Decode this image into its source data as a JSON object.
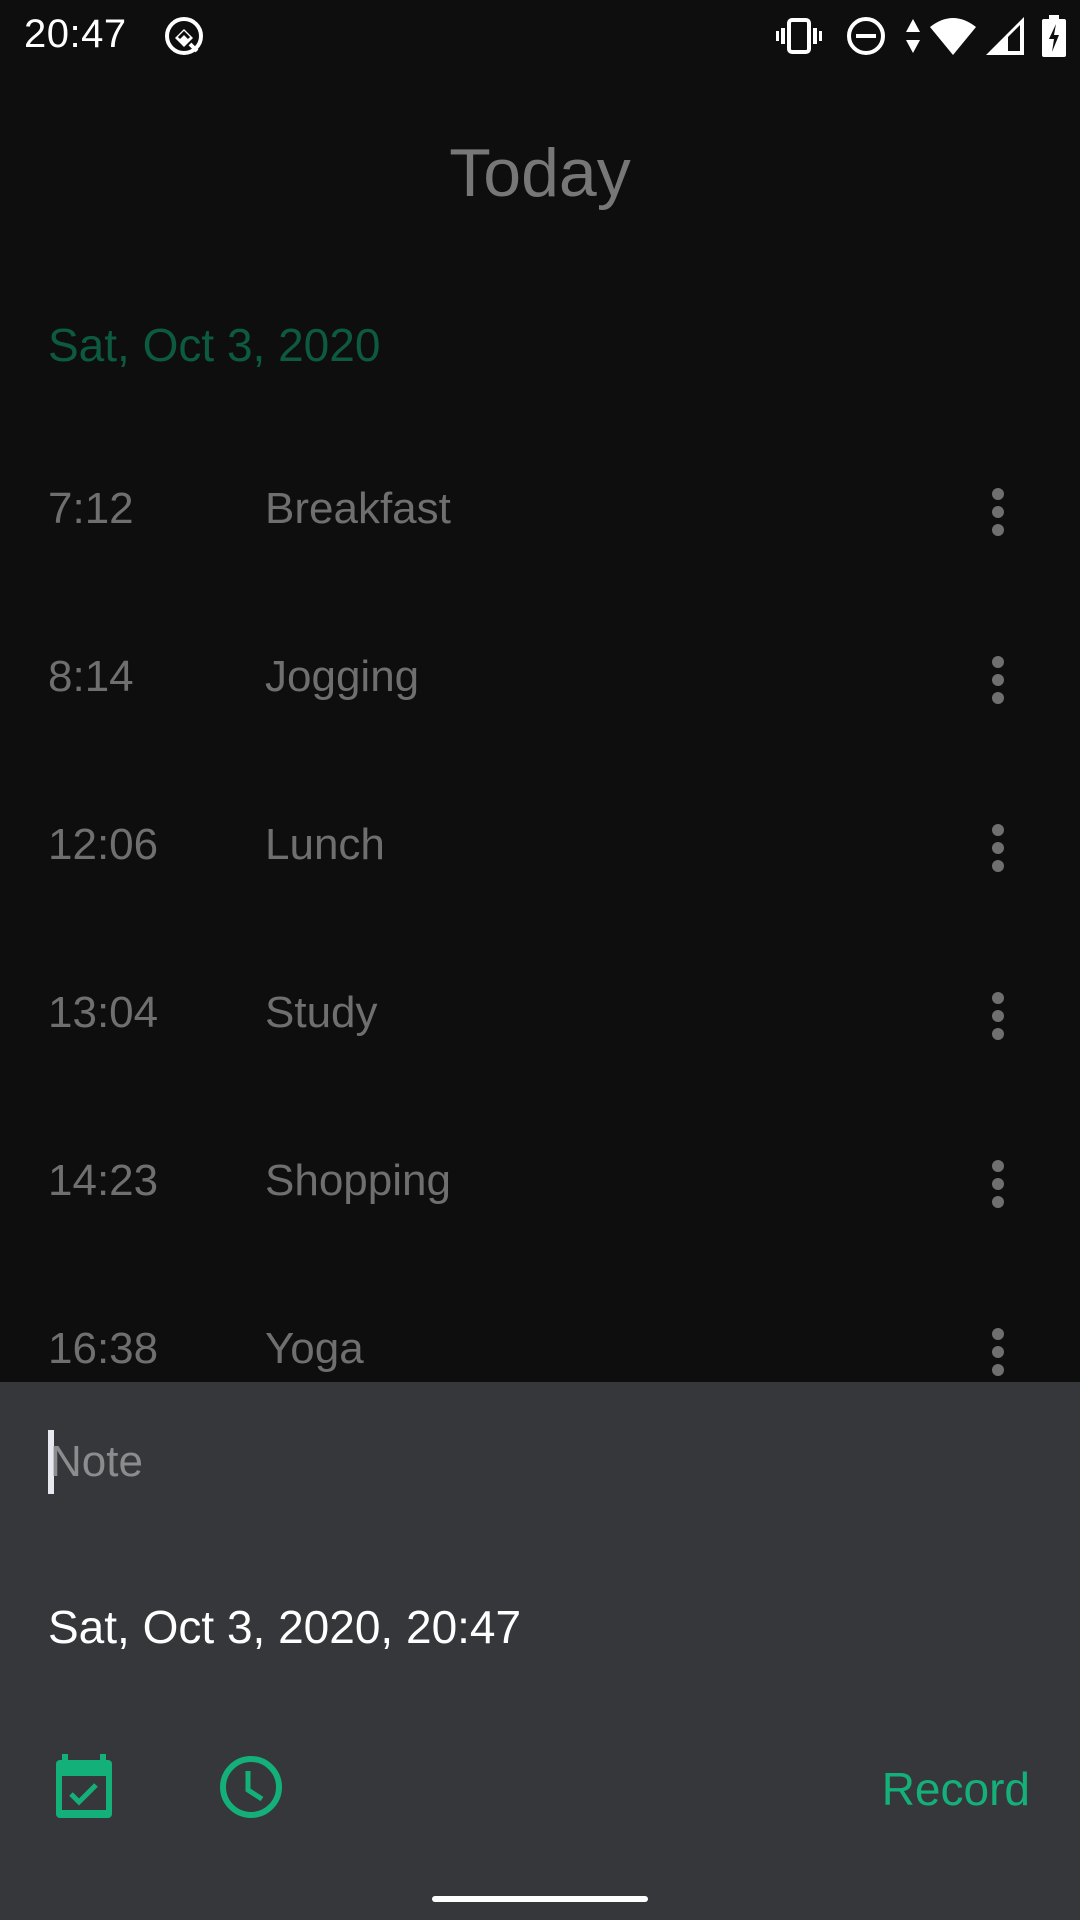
{
  "status_bar": {
    "time": "20:47",
    "icons": [
      "app-notification-icon",
      "vibrate-icon",
      "do-not-disturb-icon",
      "data-transfer-icon",
      "wifi-icon",
      "cellular-signal-icon",
      "battery-charging-icon"
    ]
  },
  "header": {
    "title": "Today"
  },
  "date_header": "Sat, Oct 3, 2020",
  "entries": [
    {
      "time": "7:12",
      "label": "Breakfast"
    },
    {
      "time": "8:14",
      "label": "Jogging"
    },
    {
      "time": "12:06",
      "label": "Lunch"
    },
    {
      "time": "13:04",
      "label": "Study"
    },
    {
      "time": "14:23",
      "label": "Shopping"
    },
    {
      "time": "16:38",
      "label": "Yoga"
    }
  ],
  "entry_menu_icon": "more-vert-icon",
  "sheet": {
    "note": {
      "value": "",
      "placeholder": "Note"
    },
    "datetime": "Sat, Oct 3, 2020, 20:47",
    "calendar_icon": "event-available-icon",
    "clock_icon": "clock-icon",
    "record_label": "Record"
  },
  "colors": {
    "accent": "#14b07a",
    "background": "#0e0e0f",
    "sheet_background": "#36373b",
    "date_header": "#0c5a40",
    "dimmed_text": "#6f6f6f"
  }
}
